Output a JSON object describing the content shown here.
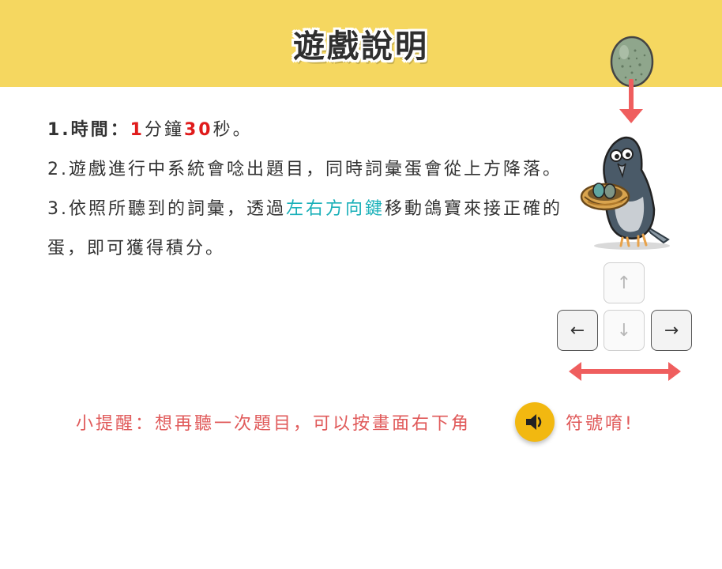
{
  "header": {
    "title": "遊戲說明"
  },
  "instructions": {
    "line1": {
      "prefix": "1.時間：",
      "minutes": "1",
      "min_unit": "分鐘",
      "seconds": "30",
      "sec_unit": "秒。"
    },
    "line2": {
      "text": "2.遊戲進行中系統會唸出題目，同時詞彙蛋會從上方降落。"
    },
    "line3": {
      "prefix": "3.依照所聽到的詞彙，透過",
      "highlight": "左右方向鍵",
      "suffix": "移動鴿寶來接正確的蛋，即可獲得積分。"
    }
  },
  "keys": {
    "up": "↑",
    "left": "←",
    "down": "↓",
    "right": "→"
  },
  "tip": {
    "before": "小提醒：想再聽一次題目，可以按畫面右下角",
    "after": "符號唷!"
  },
  "colors": {
    "header_bg": "#f5d760",
    "accent_red": "#e01b1b",
    "accent_teal": "#1ab0b9",
    "tip_text": "#e05a5a",
    "speaker_bg": "#f2b810",
    "arrow_red": "#ef5e5e"
  },
  "icons": {
    "egg": "egg-icon",
    "down": "down-arrow-icon",
    "mascot": "pigeon-mascot",
    "speaker": "speaker-icon",
    "double_arrow": "left-right-arrow-icon"
  }
}
